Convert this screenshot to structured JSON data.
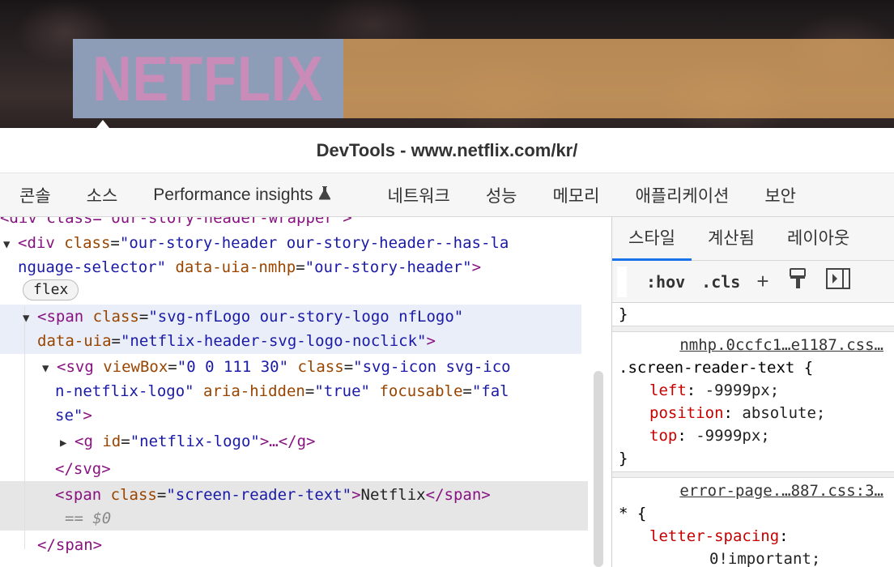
{
  "preview": {
    "logo_text": "NETFLIX"
  },
  "window": {
    "title": "DevTools - www.netflix.com/kr/"
  },
  "tabs": [
    "콘솔",
    "소스",
    "Performance insights",
    "네트워크",
    "성능",
    "메모리",
    "애플리케이션",
    "보안"
  ],
  "elements": {
    "lines": {
      "l0": {
        "tag": "<div class=\"our-story-header-wrapper\">"
      },
      "l1": {
        "open": "<div",
        "attr": "class",
        "eq": "=",
        "val": "\"our-story-header our-story-header--has-la"
      },
      "l2": {
        "val": "nguage-selector\"",
        "attr": "data-uia-nmhp",
        "eq": "=",
        "val2": "\"our-story-header\"",
        "close": ">"
      },
      "badge": "flex",
      "l3": {
        "open": "<span",
        "attr": "class",
        "eq": "=",
        "val": "\"svg-nfLogo our-story-logo nfLogo\""
      },
      "l4": {
        "attr": "data-uia",
        "eq": "=",
        "val": "\"netflix-header-svg-logo-noclick\"",
        "close": ">"
      },
      "l5": {
        "open": "<svg",
        "a1": "viewBox",
        "v1": "\"0 0 111 30\"",
        "a2": "class",
        "v2": "\"svg-icon svg-ico"
      },
      "l6": {
        "v0": "n-netflix-logo\"",
        "a1": "aria-hidden",
        "v1": "\"true\"",
        "a2": "focusable",
        "v2": "\"fal"
      },
      "l7": {
        "v0": "se\"",
        "close": ">"
      },
      "l8": {
        "open": "<g",
        "attr": "id",
        "val": "\"netflix-logo\"",
        "rest": ">…</g>"
      },
      "l9": {
        "tag": "</svg>"
      },
      "l10": {
        "open": "<span",
        "attr": "class",
        "val": "\"screen-reader-text\"",
        "close": ">",
        "text": "Netflix",
        "end": "</span>"
      },
      "l11": {
        "text": "== $0"
      },
      "l12": {
        "tag": "</span>"
      }
    }
  },
  "styles": {
    "subtabs": [
      "스타일",
      "계산됨",
      "레이아웃"
    ],
    "toolbar": {
      "hov": ":hov",
      "cls": ".cls",
      "plus": "+"
    },
    "rules": [
      {
        "brace": "}"
      },
      {
        "source": "nmhp.0ccfc1…e1187.css…",
        "selector": ".screen-reader-text {",
        "decls": [
          {
            "prop": "left",
            "value": "-9999px;"
          },
          {
            "prop": "position",
            "value": "absolute;"
          },
          {
            "prop": "top",
            "value": "-9999px;"
          }
        ],
        "close": "}"
      },
      {
        "source": "error-page.…887.css:3…",
        "selector": "* {",
        "decls": [
          {
            "prop": "letter-spacing",
            "value": "0!important;"
          }
        ]
      }
    ]
  }
}
